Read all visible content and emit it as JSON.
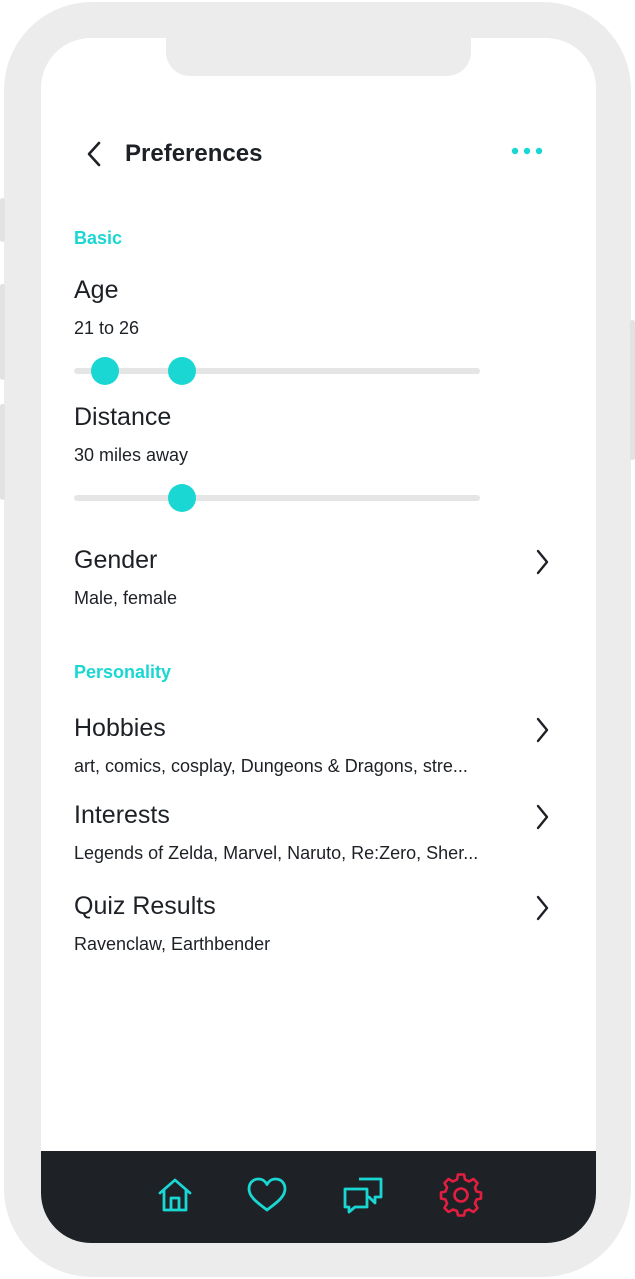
{
  "colors": {
    "accent": "#1ad7d3",
    "text": "#1d2126",
    "nav_bg": "#1e2227",
    "active_nav": "#e41e3f",
    "track": "#e5e5e5"
  },
  "header": {
    "title": "Preferences",
    "back_icon": "chevron-left-icon",
    "more_icon": "more-horizontal-icon"
  },
  "basic": {
    "section_title": "Basic",
    "age": {
      "label": "Age",
      "value": "21 to 26",
      "range_fraction": [
        0.077,
        0.266
      ]
    },
    "distance": {
      "label": "Distance",
      "value": "30 miles away",
      "fraction": 0.266
    },
    "gender": {
      "label": "Gender",
      "value": "Male, female"
    }
  },
  "personality": {
    "section_title": "Personality",
    "hobbies": {
      "label": "Hobbies",
      "value": "art, comics, cosplay, Dungeons & Dragons, stre..."
    },
    "interests": {
      "label": "Interests",
      "value": "Legends of Zelda, Marvel, Naruto, Re:Zero, Sher..."
    },
    "quiz_results": {
      "label": "Quiz Results",
      "value": "Ravenclaw, Earthbender"
    }
  },
  "bottom_nav": {
    "items": [
      {
        "icon": "home-icon",
        "active": false
      },
      {
        "icon": "heart-icon",
        "active": false
      },
      {
        "icon": "chat-icon",
        "active": false
      },
      {
        "icon": "gear-icon",
        "active": true
      }
    ]
  }
}
